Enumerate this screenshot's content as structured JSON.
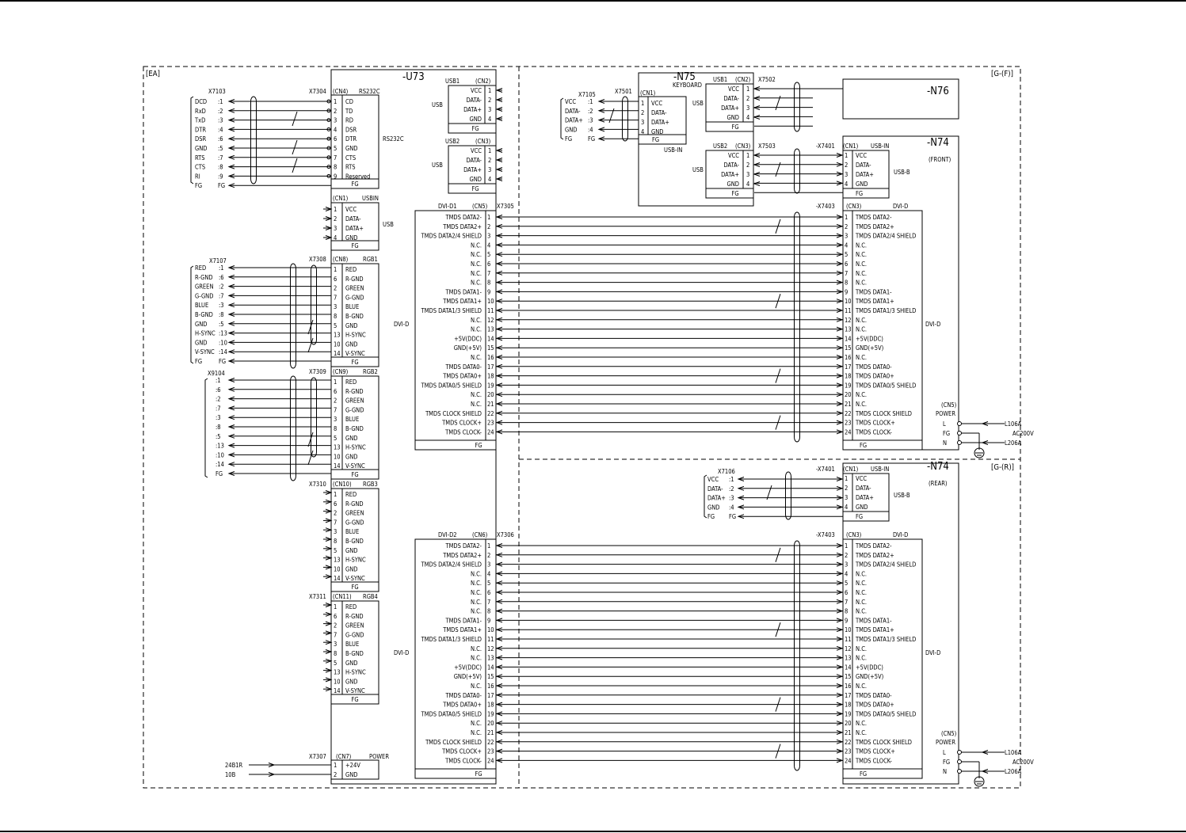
{
  "frames": {
    "ea": "EA",
    "gf": "G-(F)",
    "gr": "G-(R)"
  },
  "u73": {
    "title": "-U73",
    "usb1": {
      "head": "USB1",
      "cn": "(CN2)",
      "side": "USB",
      "pins": [
        [
          "1",
          "VCC"
        ],
        [
          "2",
          "DATA-"
        ],
        [
          "3",
          "DATA+"
        ],
        [
          "4",
          "GND"
        ]
      ],
      "fg": "FG"
    },
    "usb2": {
      "head": "USB2",
      "cn": "(CN3)",
      "side": "USB",
      "pins": [
        [
          "1",
          "VCC"
        ],
        [
          "2",
          "DATA-"
        ],
        [
          "3",
          "DATA+"
        ],
        [
          "4",
          "GND"
        ]
      ],
      "fg": "FG"
    },
    "rs232": {
      "x": "X7304",
      "cn": "(CN4)",
      "name": "RS232C",
      "side": "RS232C",
      "pins": [
        [
          "1",
          "CD"
        ],
        [
          "2",
          "TD"
        ],
        [
          "3",
          "RD"
        ],
        [
          "4",
          "DSR"
        ],
        [
          "6",
          "DTR"
        ],
        [
          "5",
          "GND"
        ],
        [
          "7",
          "CTS"
        ],
        [
          "8",
          "RTS"
        ],
        [
          "9",
          "Reserved"
        ]
      ],
      "fg": "FG"
    },
    "rs232_ext": {
      "x": "X7103",
      "signals": [
        [
          "DCD",
          ":1"
        ],
        [
          "RxD",
          ":2"
        ],
        [
          "TxD",
          ":3"
        ],
        [
          "DTR",
          ":4"
        ],
        [
          "DSR",
          ":6"
        ],
        [
          "GND",
          ":5"
        ],
        [
          "RTS",
          ":7"
        ],
        [
          "CTS",
          ":8"
        ],
        [
          "RI",
          ":9"
        ],
        [
          "FG",
          "FG"
        ]
      ]
    },
    "usbin": {
      "cn": "(CN1)",
      "name": "USBIN",
      "side": "USB",
      "pins": [
        [
          "1",
          "VCC"
        ],
        [
          "2",
          "DATA-"
        ],
        [
          "3",
          "DATA+"
        ],
        [
          "4",
          "GND"
        ]
      ],
      "fg": "FG"
    },
    "rgb1": {
      "x": "X7308",
      "cn": "(CN8)",
      "name": "RGB1"
    },
    "rgb2": {
      "x": "X7309",
      "cn": "(CN9)",
      "name": "RGB2"
    },
    "rgb3": {
      "x": "X7310",
      "cn": "(CN10)",
      "name": "RGB3"
    },
    "rgb4": {
      "x": "X7311",
      "cn": "(CN11)",
      "name": "RGB4"
    },
    "rgb_pins": [
      [
        "1",
        "RED"
      ],
      [
        "6",
        "R-GND"
      ],
      [
        "2",
        "GREEN"
      ],
      [
        "7",
        "G-GND"
      ],
      [
        "3",
        "BLUE"
      ],
      [
        "8",
        "B-GND"
      ],
      [
        "5",
        "GND"
      ],
      [
        "13",
        "H-SYNC"
      ],
      [
        "10",
        "GND"
      ],
      [
        "14",
        "V-SYNC"
      ]
    ],
    "rgb_fg": "FG",
    "rgb1_ext": {
      "x": "X7107",
      "signals": [
        [
          "RED",
          ":1"
        ],
        [
          "R-GND",
          ":6"
        ],
        [
          "GREEN",
          ":2"
        ],
        [
          "G-GND",
          ":7"
        ],
        [
          "BLUE",
          ":3"
        ],
        [
          "B-GND",
          ":8"
        ],
        [
          "GND",
          ":5"
        ],
        [
          "H-SYNC",
          ":13"
        ],
        [
          "GND",
          ":10"
        ],
        [
          "V-SYNC",
          ":14"
        ],
        [
          "FG",
          "FG"
        ]
      ]
    },
    "rgb2_ext": {
      "x": "X9104",
      "signals": [
        ":1",
        ":6",
        ":2",
        ":7",
        ":3",
        ":8",
        ":5",
        ":13",
        ":10",
        ":14",
        "FG"
      ]
    },
    "dvi1": {
      "head": "DVI-D1",
      "cn": "(CN5)",
      "x": "X7305",
      "side": "DVI-D"
    },
    "dvi2": {
      "head": "DVI-D2",
      "cn": "(CN6)",
      "x": "X7306",
      "side": "DVI-D"
    },
    "power": {
      "x": "X7307",
      "cn": "(CN7)",
      "name": "POWER",
      "pins": [
        [
          "1",
          "+24V"
        ],
        [
          "2",
          "GND"
        ]
      ],
      "ext": [
        "24B1R",
        "10B"
      ]
    }
  },
  "dvi_pins": [
    [
      "1",
      "TMDS DATA2-"
    ],
    [
      "2",
      "TMDS DATA2+"
    ],
    [
      "3",
      "TMDS DATA2/4 SHIELD"
    ],
    [
      "4",
      "N.C."
    ],
    [
      "5",
      "N.C."
    ],
    [
      "6",
      "N.C."
    ],
    [
      "7",
      "N.C."
    ],
    [
      "8",
      "N.C."
    ],
    [
      "9",
      "TMDS DATA1-"
    ],
    [
      "10",
      "TMDS DATA1+"
    ],
    [
      "11",
      "TMDS DATA1/3 SHIELD"
    ],
    [
      "12",
      "N.C."
    ],
    [
      "13",
      "N.C."
    ],
    [
      "14",
      "+5V(DDC)"
    ],
    [
      "15",
      "GND(+5V)"
    ],
    [
      "16",
      "N.C."
    ],
    [
      "17",
      "TMDS DATA0-"
    ],
    [
      "18",
      "TMDS DATA0+"
    ],
    [
      "19",
      "TMDS DATA0/5 SHIELD"
    ],
    [
      "20",
      "N.C."
    ],
    [
      "21",
      "N.C."
    ],
    [
      "22",
      "TMDS CLOCK SHIELD"
    ],
    [
      "23",
      "TMDS CLOCK+"
    ],
    [
      "24",
      "TMDS CLOCK-"
    ]
  ],
  "dvi_fg": "FG",
  "n75": {
    "title": "-N75",
    "sub": "KEYBOARD",
    "cn1": {
      "x": "X7501",
      "cn": "(CN1)",
      "label": "USB-IN",
      "pins": [
        [
          "1",
          "VCC"
        ],
        [
          "2",
          "DATA-"
        ],
        [
          "3",
          "DATA+"
        ],
        [
          "4",
          "GND"
        ]
      ],
      "fg": "FG"
    },
    "ext": {
      "x": "X7105",
      "signals": [
        [
          "VCC",
          ":1"
        ],
        [
          "DATA-",
          ":2"
        ],
        [
          "DATA+",
          ":3"
        ],
        [
          "GND",
          ":4"
        ],
        [
          "FG",
          "FG"
        ]
      ]
    },
    "usb1": {
      "head": "USB1",
      "cn": "(CN2)",
      "x": "X7502",
      "side": "USB",
      "pins": [
        [
          "VCC",
          "1"
        ],
        [
          "DATA-",
          "2"
        ],
        [
          "DATA+",
          "3"
        ],
        [
          "GND",
          "4"
        ]
      ],
      "fg": "FG"
    },
    "usb2": {
      "head": "USB2",
      "cn": "(CN3)",
      "x": "X7503",
      "side": "USB",
      "pins": [
        [
          "VCC",
          "1"
        ],
        [
          "DATA-",
          "2"
        ],
        [
          "DATA+",
          "3"
        ],
        [
          "GND",
          "4"
        ]
      ],
      "fg": "FG"
    }
  },
  "n76": {
    "title": "-N76"
  },
  "n74f": {
    "title": "-N74",
    "sub": "(FRONT)",
    "usb": {
      "x": "-X7401",
      "cn": "(CN1)",
      "name": "USB-IN",
      "side": "USB-B",
      "pins": [
        [
          "1",
          "VCC"
        ],
        [
          "2",
          "DATA-"
        ],
        [
          "3",
          "DATA+"
        ],
        [
          "4",
          "GND"
        ]
      ],
      "fg": "FG"
    },
    "dvi": {
      "x": "-X7403",
      "cn": "(CN3)",
      "name": "DVI-D",
      "side": "DVI-D"
    },
    "power": {
      "cn": "(CN5)",
      "name": "POWER",
      "terms": [
        "L",
        "FG",
        "N"
      ],
      "lines": [
        "L106A",
        "AC200V",
        "L206A"
      ]
    }
  },
  "n74r": {
    "title": "-N74",
    "sub": "(REAR)",
    "usb": {
      "x": "-X7401",
      "cn": "(CN1)",
      "name": "USB-IN",
      "side": "USB-B",
      "pins": [
        [
          "1",
          "VCC"
        ],
        [
          "2",
          "DATA-"
        ],
        [
          "3",
          "DATA+"
        ],
        [
          "4",
          "GND"
        ]
      ],
      "fg": "FG"
    },
    "ext": {
      "x": "X7106",
      "signals": [
        [
          "VCC",
          ":1"
        ],
        [
          "DATA-",
          ":2"
        ],
        [
          "DATA+",
          ":3"
        ],
        [
          "GND",
          ":4"
        ],
        [
          "FG",
          "FG"
        ]
      ]
    },
    "dvi": {
      "x": "-X7403",
      "cn": "(CN3)",
      "name": "DVI-D",
      "side": "DVI-D"
    },
    "power": {
      "cn": "(CN5)",
      "name": "POWER",
      "terms": [
        "L",
        "FG",
        "N"
      ],
      "lines": [
        "L106A",
        "AC200V",
        "L206A"
      ]
    }
  }
}
